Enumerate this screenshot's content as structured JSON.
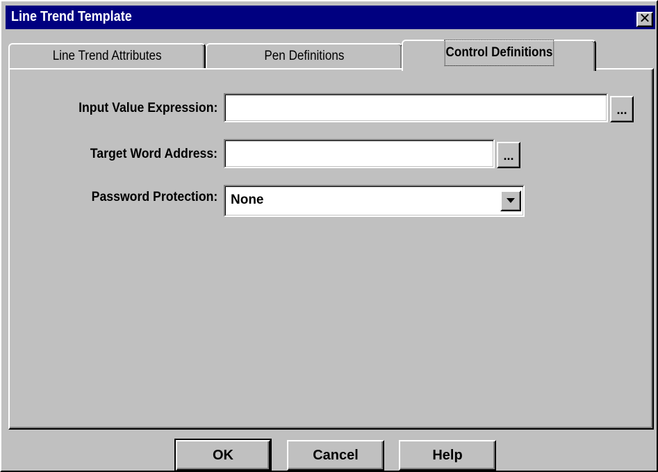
{
  "window": {
    "title": "Line Trend Template",
    "close_glyph": "✕"
  },
  "tabs": [
    {
      "label": "Line Trend Attributes",
      "active": false
    },
    {
      "label": "Pen Definitions",
      "active": false
    },
    {
      "label": "Control Definitions",
      "active": true
    }
  ],
  "form": {
    "input_value_expression": {
      "label": "Input Value Expression:",
      "value": "",
      "browse": "..."
    },
    "target_word_address": {
      "label": "Target Word Address:",
      "value": "",
      "browse": "..."
    },
    "password_protection": {
      "label": "Password Protection:",
      "value": "None",
      "icon": "chevron-down-icon"
    }
  },
  "buttons": {
    "ok": "OK",
    "cancel": "Cancel",
    "help": "Help"
  },
  "colors": {
    "titlebar": "#000080",
    "face": "#c0c0c0",
    "field": "#ffffff"
  }
}
